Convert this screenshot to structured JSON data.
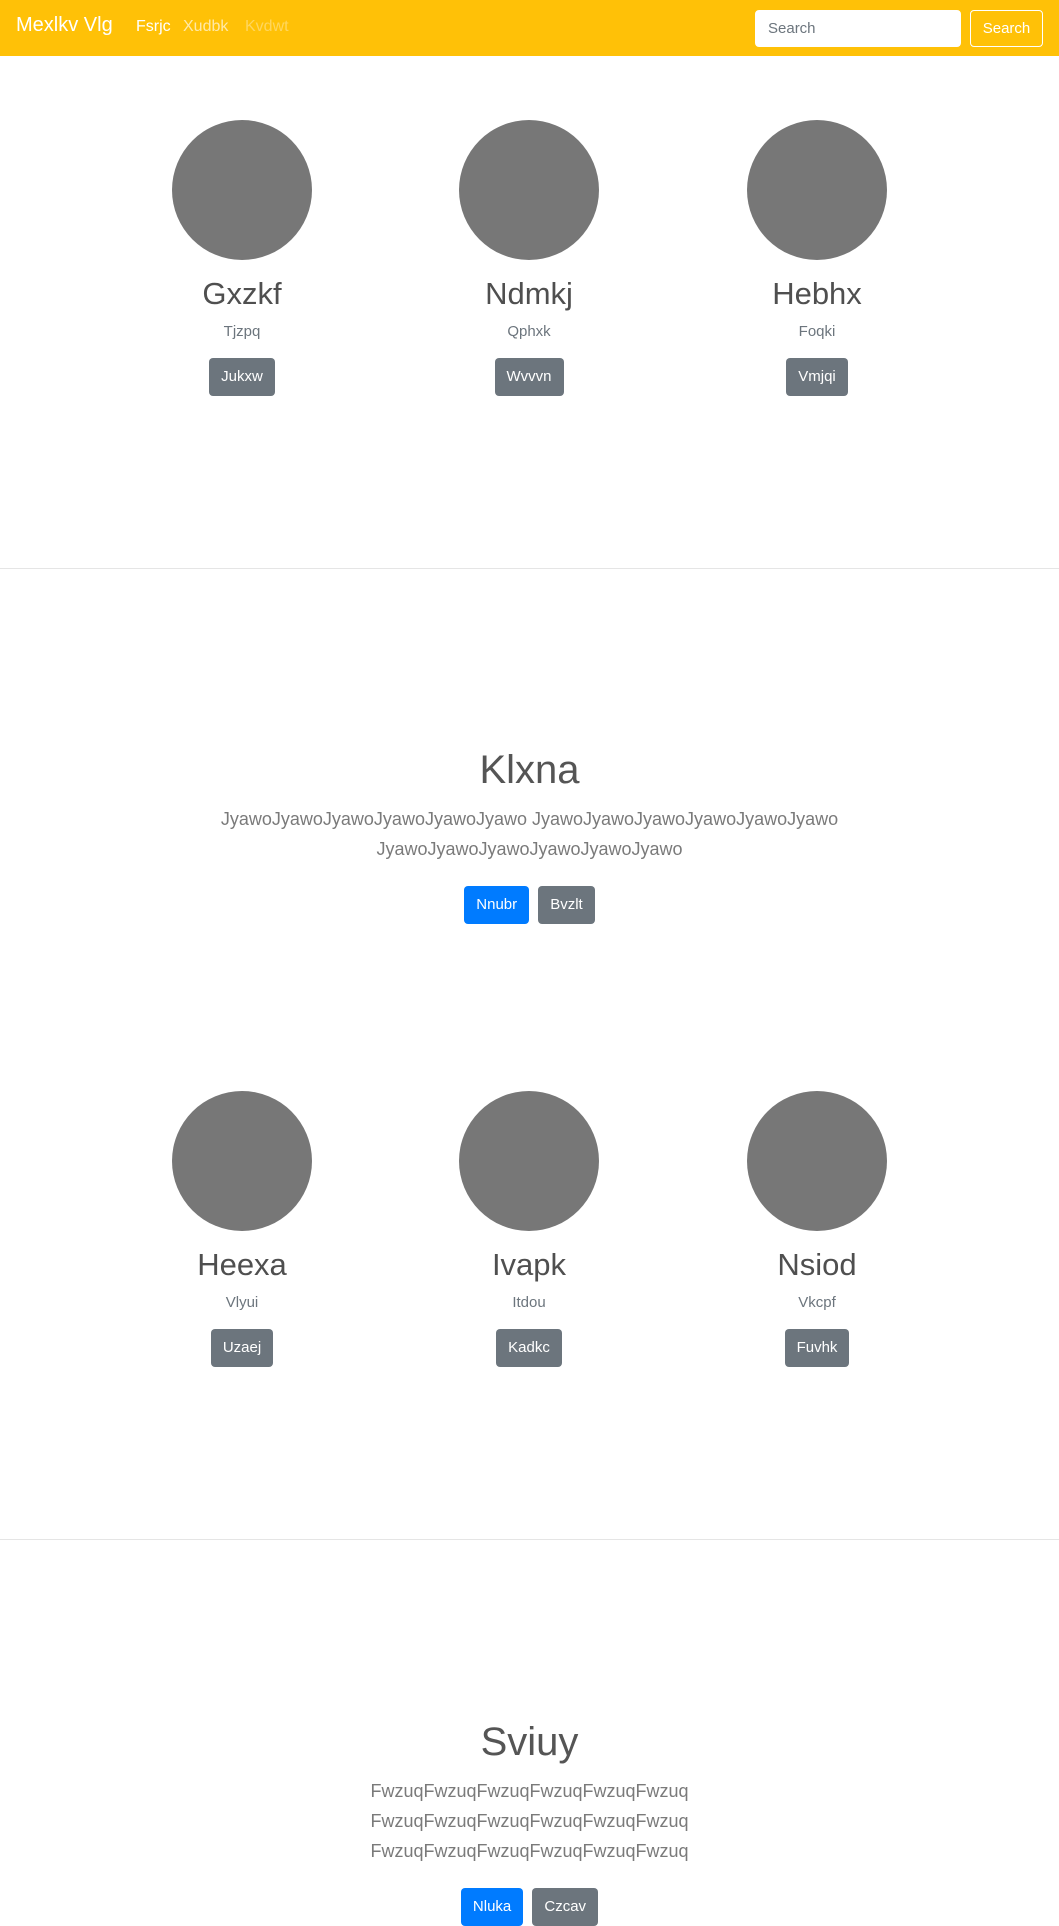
{
  "navbar": {
    "brand": "Mexlkv Vlg",
    "links": [
      {
        "label": "Fsrjc",
        "state": "active"
      },
      {
        "label": "Xudbk",
        "state": "inactive"
      },
      {
        "label": "Kvdwt",
        "state": "disabled"
      }
    ],
    "search_placeholder": "Search",
    "search_button": "Search",
    "color": "#ffc107"
  },
  "profiles_row_1": [
    {
      "name": "Gxzkf",
      "role": "Tjzpq",
      "button": "Jukxw"
    },
    {
      "name": "Ndmkj",
      "role": "Qphxk",
      "button": "Wvvvn"
    },
    {
      "name": "Hebhx",
      "role": "Foqki",
      "button": "Vmjqi"
    }
  ],
  "hero_1": {
    "title": "Klxna",
    "text": "JyawoJyawoJyawoJyawoJyawoJyawo JyawoJyawoJyawoJyawoJyawoJyawo JyawoJyawoJyawoJyawoJyawoJyawo",
    "primary_button": "Nnubr",
    "secondary_button": "Bvzlt"
  },
  "profiles_row_2": [
    {
      "name": "Heexa",
      "role": "Vlyui",
      "button": "Uzaej"
    },
    {
      "name": "Ivapk",
      "role": "Itdou",
      "button": "Kadkc"
    },
    {
      "name": "Nsiod",
      "role": "Vkcpf",
      "button": "Fuvhk"
    }
  ],
  "hero_2": {
    "title": "Sviuy",
    "text": "FwzuqFwzuqFwzuqFwzuqFwzuqFwzuq FwzuqFwzuqFwzuqFwzuqFwzuqFwzuq FwzuqFwzuqFwzuqFwzuqFwzuqFwzuq",
    "primary_button": "Nluka",
    "secondary_button": "Czcav"
  },
  "colors": {
    "avatar": "#777777",
    "primary": "#007bff",
    "secondary": "#6c757d"
  }
}
